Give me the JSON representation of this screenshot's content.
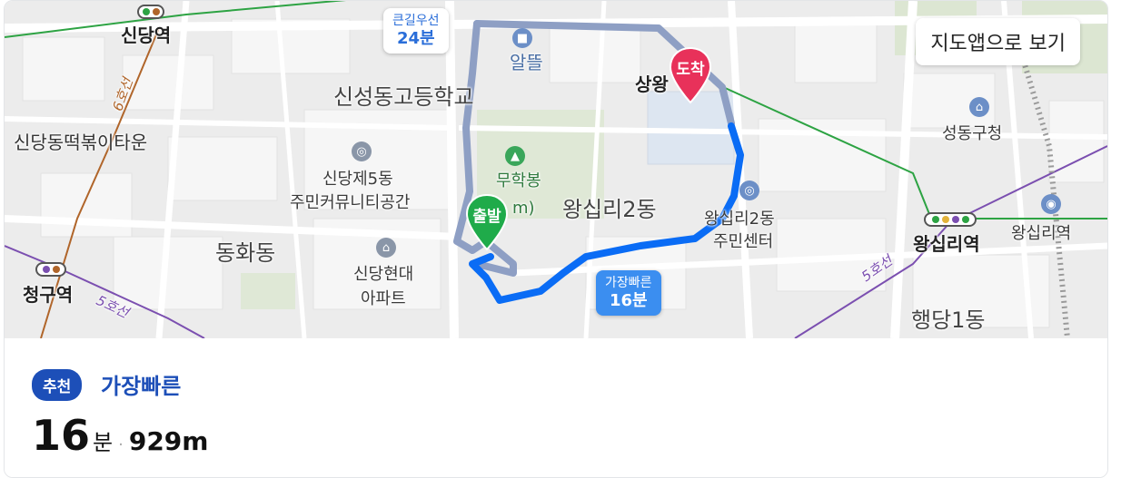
{
  "map": {
    "open_in_app": "지도앱으로 보기",
    "start_marker": "출발",
    "end_marker": "도착",
    "main_route_callout": {
      "label": "가장빠른",
      "time": "16분"
    },
    "alt_route_callout": {
      "label": "큰길우선",
      "time": "24분"
    },
    "labels": {
      "sindang_station": "신당역",
      "sindang_tteokbokki": "신당동떡볶이타운",
      "sinseong_school": "신성동고등학교",
      "altteul": "알뜰",
      "sangwang": "상왕",
      "sindang5_1": "신당제5동",
      "sindang5_2": "주민커뮤니티공간",
      "muhakbong": "무학봉",
      "muhakbong_suffix": "m)",
      "wangsimni2": "왕십리2동",
      "wangsimni2_center_1": "왕십리2동",
      "wangsimni2_center_2": "주민센터",
      "donghwa": "동화동",
      "sindang_hyundai_1": "신당현대",
      "sindang_hyundai_2": "아파트",
      "cheonggu": "청구역",
      "wangsimni_station": "왕십리역",
      "wangsimni_station2": "왕십리역",
      "seongdong_office": "성동구청",
      "haengdang1": "행당1동",
      "line6": "6호선",
      "line5_left": "5호선",
      "line5_right": "5호선"
    }
  },
  "route": {
    "badge": "추천",
    "type": "가장빠른",
    "minutes": "16",
    "minutes_unit": "분",
    "separator": "·",
    "distance": "929m"
  },
  "colors": {
    "route_blue": "#0a6cf5",
    "alt_route": "#8e9fc4",
    "start_green": "#1fab4a",
    "end_red": "#e8315a",
    "badge_blue": "#1d4fb8"
  }
}
